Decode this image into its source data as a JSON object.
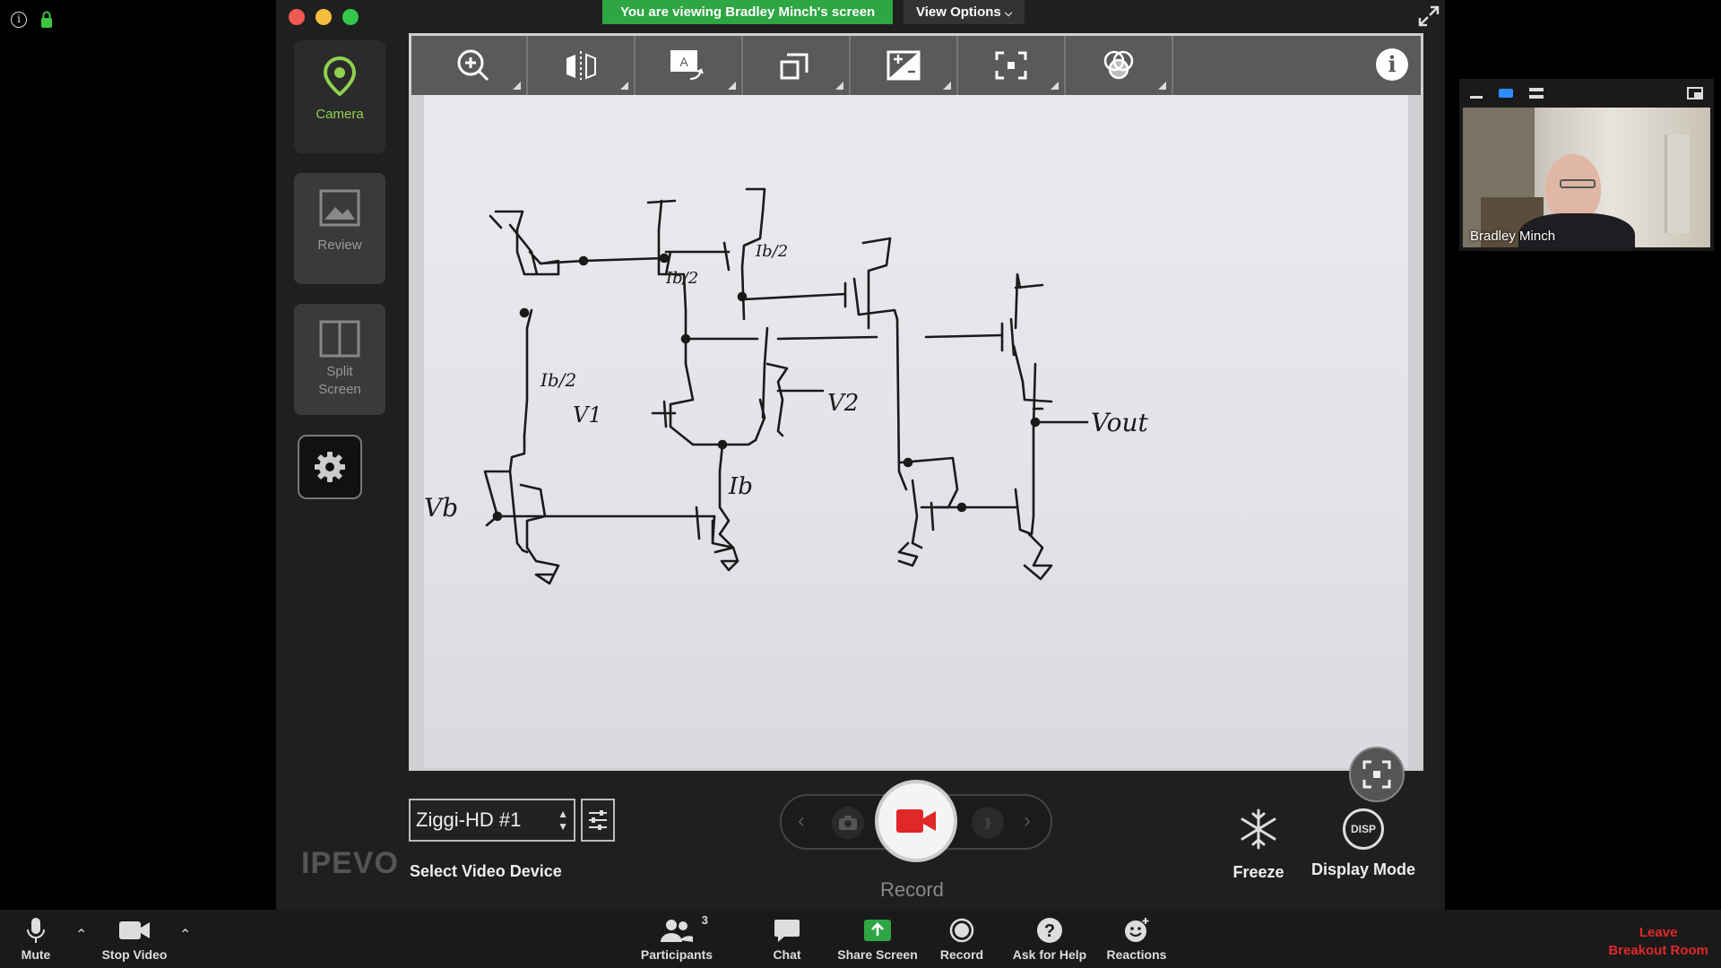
{
  "meeting": {
    "banner": "You are viewing Bradley Minch's screen",
    "view_options": "View Options",
    "view_options_icon": "chevron-down-icon"
  },
  "app_rail": {
    "camera": "Camera",
    "review": "Review",
    "split_screen_line1": "Split",
    "split_screen_line2": "Screen",
    "brand": "IPEVO"
  },
  "camera_toolbar": {
    "tools": [
      "zoom-in-icon",
      "mirror-flip-icon",
      "auto-focus-icon",
      "rotate-icon",
      "exposure-icon",
      "crop-icon",
      "color-filter-icon"
    ]
  },
  "whiteboard_labels": {
    "i_half_1": "Ib/2",
    "i_half_2": "Ib/2",
    "i_half_3": "Ib/2",
    "v1": "V1",
    "v2": "V2",
    "ib": "Ib",
    "vb": "Vb",
    "vout": "Vout"
  },
  "device": {
    "selected": "Ziggi-HD #1",
    "label": "Select Video Device"
  },
  "capture": {
    "record_label": "Record",
    "freeze": "Freeze",
    "display_mode": "Display Mode",
    "display_icon_text": "DISP"
  },
  "participant": {
    "name": "Bradley Minch"
  },
  "zoom_toolbar": {
    "mute": "Mute",
    "stop_video": "Stop Video",
    "participants": "Participants",
    "participants_count": "3",
    "chat": "Chat",
    "share_screen": "Share Screen",
    "record": "Record",
    "ask_for_help": "Ask for Help",
    "reactions": "Reactions",
    "leave_line1": "Leave",
    "leave_line2": "Breakout Room"
  },
  "colors": {
    "banner_green": "#2ea643",
    "camera_green": "#8fd14f",
    "record_red": "#e02828",
    "leave_red": "#e02828"
  }
}
